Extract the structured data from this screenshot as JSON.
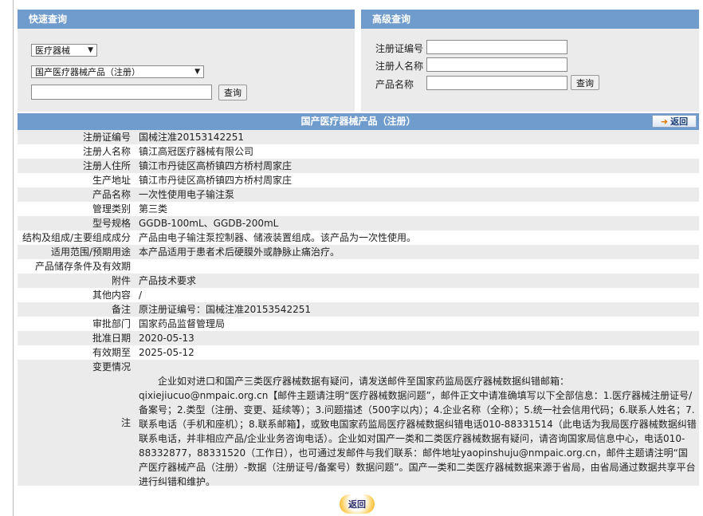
{
  "quick_search": {
    "title": "快速查询",
    "category_select": "医疗器械",
    "type_select": "国产医疗器械产品（注册）",
    "keyword_value": "",
    "search_label": "查询"
  },
  "advanced_search": {
    "title": "高级查询",
    "reg_no_label": "注册证编号",
    "registrant_label": "注册人名称",
    "product_label": "产品名称",
    "search_label": "查询"
  },
  "detail": {
    "header": "国产医疗器械产品（注册）",
    "return_label": "返回",
    "rows": [
      {
        "label": "注册证编号",
        "value": "国械注准20153142251"
      },
      {
        "label": "注册人名称",
        "value": "镇江高冠医疗器械有限公司"
      },
      {
        "label": "注册人住所",
        "value": "镇江市丹徒区高桥镇四方桥村周家庄"
      },
      {
        "label": "生产地址",
        "value": "镇江市丹徒区高桥镇四方桥村周家庄"
      },
      {
        "label": "产品名称",
        "value": "一次性使用电子输注泵"
      },
      {
        "label": "管理类别",
        "value": "第三类"
      },
      {
        "label": "型号规格",
        "value": "GGDB-100mL、GGDB-200mL"
      },
      {
        "label": "结构及组成/主要组成成分",
        "value": "产品由电子输注泵控制器、储液装置组成。该产品为一次性使用。"
      },
      {
        "label": "适用范围/预期用途",
        "value": "本产品适用于患者术后硬膜外或静脉止痛治疗。"
      },
      {
        "label": "产品储存条件及有效期",
        "value": ""
      },
      {
        "label": "附件",
        "value": "产品技术要求"
      },
      {
        "label": "其他内容",
        "value": "/"
      },
      {
        "label": "备注",
        "value": "原注册证编号：国械注准20153542251"
      },
      {
        "label": "审批部门",
        "value": "国家药品监督管理局"
      },
      {
        "label": "批准日期",
        "value": "2020-05-13"
      },
      {
        "label": "有效期至",
        "value": "2025-05-12"
      }
    ],
    "change_label": "变更情况",
    "note_label": "注",
    "note_text": "企业如对进口和国产三类医疗器械数据有疑问，请发送邮件至国家药监局医疗器械数据纠错邮箱：qixiejiucuo@nmpaic.org.cn【邮件主题请注明“医疗器械数据问题”，邮件正文中请准确填写以下全部信息：1.医疗器械注册证号/备案号；2.类型（注册、变更、延续等）；3.问题描述（500字以内）；4.企业名称（全称）；5.统一社会信用代码；6.联系人姓名；7.联系电话（手机和座机）；8.联系邮箱】，或致电国家药监局医疗器械数据纠错电话010-88331514（此电话为我局医疗器械数据纠错联系电话，并非相应产品/企业业务咨询电话）。企业如对国产一类和二类医疗器械数据有疑问，请咨询国家局信息中心，电话010-88332877，88331520（工作日），也可通过发邮件与我们联系：邮件地址yaopinshuju@nmpaic.org.cn，邮件主题请注明“国产医疗器械产品（注册）-数据（注册证号/备案号）数据问题”。国产一类和二类医疗器械数据来源于省局，由省局通过数据共享平台进行纠错和维护。"
  },
  "footer": {
    "return_label": "返回"
  }
}
